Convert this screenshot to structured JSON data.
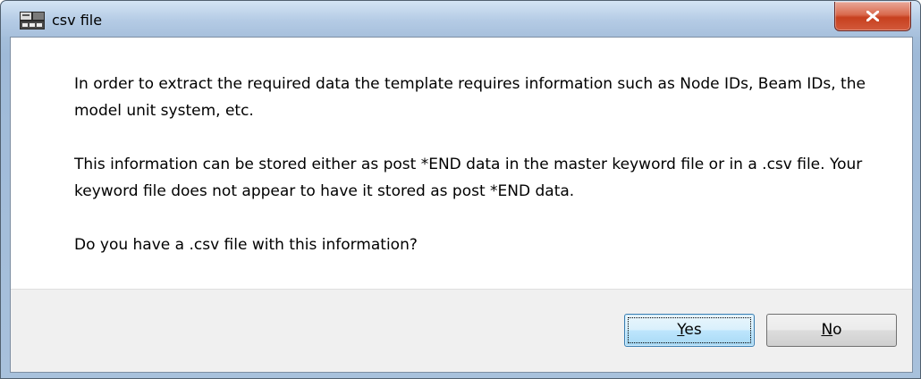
{
  "window": {
    "title": "csv file",
    "app_icon": "application-icon",
    "close_icon": "close-icon"
  },
  "message": {
    "paragraph_1": "In order to extract the required data the template requires information such as Node IDs, Beam IDs, the model unit system, etc.",
    "paragraph_2": "This information can be stored either as post *END data in the master keyword file or in a .csv file.  Your keyword file does not appear to have it stored as post *END data.",
    "paragraph_3": "Do you have a .csv file with this information?"
  },
  "buttons": {
    "yes": {
      "mnemonic": "Y",
      "rest": "es"
    },
    "no": {
      "mnemonic": "N",
      "rest": "o"
    }
  },
  "colors": {
    "close_button": "#c7401f",
    "default_button_border": "#3c7fb1",
    "footer_background": "#f0f0f0"
  }
}
